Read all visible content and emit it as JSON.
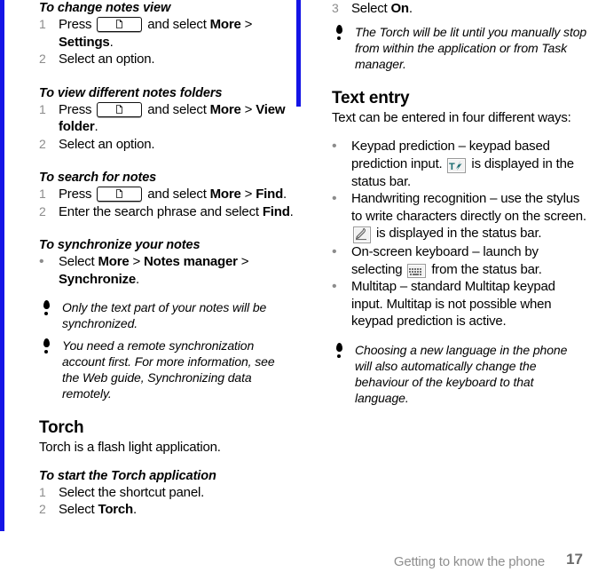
{
  "page": {
    "footer_title": "Getting to know the phone",
    "footer_page_number": "17",
    "accent_color": "#1414e6",
    "marker_color": "#8c8c8c",
    "footer_text_color": "#8e8e8e"
  },
  "left_column": {
    "sections": [
      {
        "heading": "To change notes view",
        "steps": [
          {
            "marker": "1",
            "pre": "Press ",
            "key_icon": "notes-key-icon",
            "post_plain": " and select ",
            "post_bold": "More",
            "tail_plain": " > ",
            "tail_bold": "Settings",
            "end": "."
          },
          {
            "marker": "2",
            "text": "Select an option."
          }
        ]
      },
      {
        "heading": "To view different notes folders",
        "steps": [
          {
            "marker": "1",
            "pre": "Press ",
            "key_icon": "notes-key-icon",
            "post_plain": " and select ",
            "post_bold": "More",
            "tail_plain": " > ",
            "tail_bold": "View folder",
            "end": "."
          },
          {
            "marker": "2",
            "text": "Select an option."
          }
        ]
      },
      {
        "heading": "To search for notes",
        "steps": [
          {
            "marker": "1",
            "pre": "Press ",
            "key_icon": "notes-key-icon",
            "post_plain": " and select ",
            "post_bold": "More",
            "tail_plain": " > ",
            "tail_bold": "Find",
            "end": "."
          },
          {
            "marker": "2",
            "pre": "Enter the search phrase and select ",
            "post_bold": "Find",
            "end": "."
          }
        ]
      },
      {
        "heading": "To synchronize your notes",
        "steps": [
          {
            "marker": "•",
            "pre": "Select ",
            "post_bold": "More",
            "tail_plain": " > ",
            "tail_bold": "Notes manager",
            "tail2_plain": " > ",
            "tail2_bold": "Synchronize",
            "end": "."
          }
        ]
      }
    ],
    "notes": [
      "Only the text part of your notes will be synchronized.",
      "You need a remote synchronization account first. For more information, see the Web guide, Synchronizing data remotely."
    ],
    "torch": {
      "heading": "Torch",
      "intro": "Torch is a flash light application.",
      "sub_heading": "To start the Torch application",
      "steps": [
        {
          "marker": "1",
          "text": "Select the shortcut panel."
        },
        {
          "marker": "2",
          "pre": "Select ",
          "post_bold": "Torch",
          "end": "."
        }
      ]
    }
  },
  "right_column": {
    "torch_step3": {
      "marker": "3",
      "pre": "Select ",
      "post_bold": "On",
      "end": "."
    },
    "torch_note": "The Torch will be lit until you manually stop from within the application or from Task manager.",
    "text_entry": {
      "heading": "Text entry",
      "intro": "Text can be entered in four different ways:",
      "items": [
        {
          "marker": "•",
          "part1": "Keypad prediction – keypad based prediction input. ",
          "icon": "keypad-prediction-icon",
          "part2": " is displayed in the status bar."
        },
        {
          "marker": "•",
          "part1": "Handwriting recognition – use the stylus to write characters directly on the screen. ",
          "icon": "handwriting-icon",
          "part2": " is displayed in the status bar."
        },
        {
          "marker": "•",
          "part1": "On-screen keyboard – launch by selecting ",
          "icon": "onscreen-keyboard-icon",
          "part2": " from the status bar."
        },
        {
          "marker": "•",
          "part1": "Multitap – standard Multitap keypad input. Multitap is not possible when keypad prediction is active.",
          "icon": null,
          "part2": ""
        }
      ]
    },
    "language_note": "Choosing a new language in the phone will also automatically change the behaviour of the keyboard to that language."
  }
}
